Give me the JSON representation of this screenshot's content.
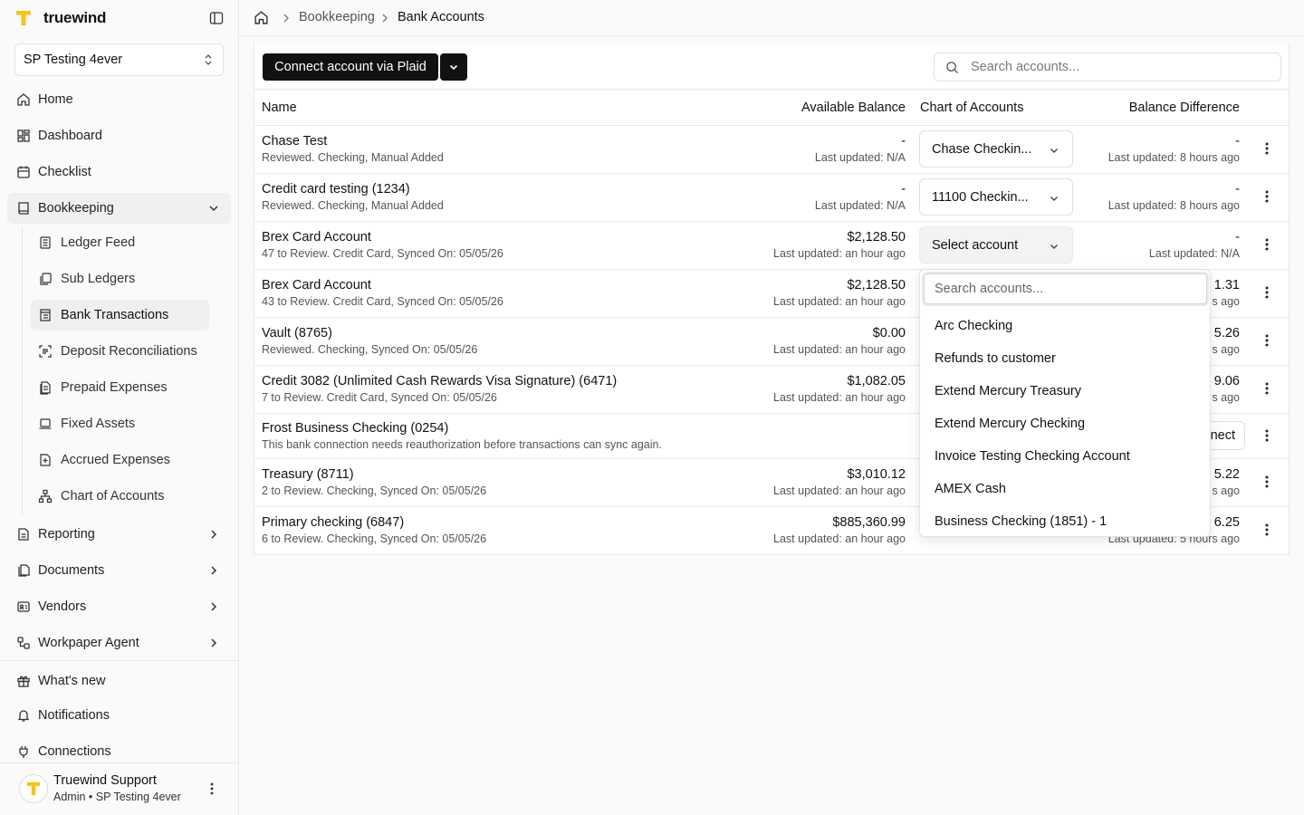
{
  "app": {
    "brand": "truewind"
  },
  "org": {
    "name": "SP Testing 4ever"
  },
  "sidebar": {
    "home": "Home",
    "dashboard": "Dashboard",
    "checklist": "Checklist",
    "bookkeeping": "Bookkeeping",
    "sub": {
      "ledger_feed": "Ledger Feed",
      "sub_ledgers": "Sub Ledgers",
      "bank_transactions": "Bank Transactions",
      "deposit_reconciliations": "Deposit Reconciliations",
      "prepaid_expenses": "Prepaid Expenses",
      "fixed_assets": "Fixed Assets",
      "accrued_expenses": "Accrued Expenses",
      "chart_of_accounts": "Chart of Accounts"
    },
    "reporting": "Reporting",
    "documents": "Documents",
    "vendors": "Vendors",
    "workpaper_agent": "Workpaper Agent",
    "whats_new": "What's new",
    "notifications": "Notifications",
    "connections": "Connections"
  },
  "user": {
    "name": "Truewind Support",
    "role": "Admin • SP Testing 4ever"
  },
  "breadcrumb": {
    "parent": "Bookkeeping",
    "current": "Bank Accounts"
  },
  "toolbar": {
    "connect_label": "Connect account via Plaid",
    "search_placeholder": "Search accounts..."
  },
  "table": {
    "columns": {
      "name": "Name",
      "available_balance": "Available Balance",
      "chart_of_accounts": "Chart of Accounts",
      "balance_difference": "Balance Difference"
    },
    "rows": [
      {
        "name": "Chase Test",
        "sub": "Reviewed. Checking, Manual Added",
        "balance": "-",
        "balance_updated": "Last updated: N/A",
        "account": "Chase Checkin...",
        "diff": "-",
        "diff_updated": "Last updated: 8 hours ago"
      },
      {
        "name": "Credit card testing (1234)",
        "sub": "Reviewed. Checking, Manual Added",
        "balance": "-",
        "balance_updated": "Last updated: N/A",
        "account": "11100 Checkin...",
        "diff": "-",
        "diff_updated": "Last updated: 8 hours ago"
      },
      {
        "name": "Brex Card Account",
        "sub": "47 to Review. Credit Card, Synced On: 05/05/26",
        "balance": "$2,128.50",
        "balance_updated": "Last updated: an hour ago",
        "account": "Select account",
        "diff": "-",
        "diff_updated": "Last updated: N/A"
      },
      {
        "name": "Brex Card Account",
        "sub": "43 to Review. Credit Card, Synced On: 05/05/26",
        "balance": "$2,128.50",
        "balance_updated": "Last updated: an hour ago",
        "diff": "1.31",
        "diff_updated": "s ago"
      },
      {
        "name": "Vault (8765)",
        "sub": "Reviewed. Checking, Synced On: 05/05/26",
        "balance": "$0.00",
        "balance_updated": "Last updated: an hour ago",
        "diff": "5.26",
        "diff_updated": "s ago"
      },
      {
        "name": "Credit 3082 (Unlimited Cash Rewards Visa Signature) (6471)",
        "sub": "7 to Review. Credit Card, Synced On: 05/05/26",
        "balance": "$1,082.05",
        "balance_updated": "Last updated: an hour ago",
        "diff": "9.06",
        "diff_updated": "s ago"
      },
      {
        "name": "Frost Business Checking (0254)",
        "sub": "This bank connection needs reauthorization before transactions can sync again.",
        "action": "nect"
      },
      {
        "name": "Treasury (8711)",
        "sub": "2 to Review. Checking, Synced On: 05/05/26",
        "balance": "$3,010.12",
        "balance_updated": "Last updated: an hour ago",
        "diff": "5.22",
        "diff_updated": "s ago"
      },
      {
        "name": "Primary checking (6847)",
        "sub": "6 to Review. Checking, Synced On: 05/05/26",
        "balance": "$885,360.99",
        "balance_updated": "Last updated: an hour ago",
        "diff": "6.25",
        "diff_updated": "Last updated: 5 hours ago"
      }
    ]
  },
  "dropdown": {
    "search_placeholder": "Search accounts...",
    "options": [
      "Arc Checking",
      "Refunds to customer",
      "Extend Mercury Treasury",
      "Extend Mercury Checking",
      "Invoice Testing Checking Account",
      "AMEX Cash",
      "Business Checking (1851) - 1"
    ]
  },
  "colors": {
    "brand_yellow": "#F5C518",
    "primary_button": "#111111"
  }
}
